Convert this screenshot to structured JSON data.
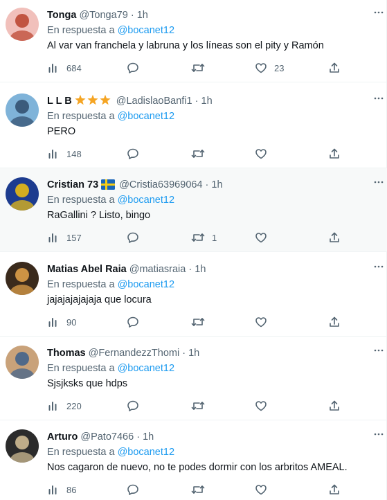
{
  "tweets": [
    {
      "name": "Tonga",
      "handle": "@Tonga79",
      "dot": "·",
      "time": "1h",
      "reply_prefix": "En respuesta a",
      "reply_to": "@bocanet12",
      "text": "Al var van franchela y labruna y los líneas son el pity y Ramón",
      "views": "684",
      "replies": "",
      "retweets": "",
      "likes": "23",
      "badge": "",
      "highlight": false,
      "avatar_colors": [
        "#f1c0bb",
        "#b9412b"
      ]
    },
    {
      "name": "L L B",
      "handle": "@LadislaoBanfi1",
      "dot": "·",
      "time": "1h",
      "reply_prefix": "En respuesta a",
      "reply_to": "@bocanet12",
      "text": "PERO",
      "views": "148",
      "replies": "",
      "retweets": "",
      "likes": "",
      "badge": "stars",
      "highlight": false,
      "avatar_colors": [
        "#7fb3d9",
        "#2f4b6b"
      ]
    },
    {
      "name": "Cristian 73",
      "handle": "@Cristia63969064",
      "dot": "·",
      "time": "1h",
      "reply_prefix": "En respuesta a",
      "reply_to": "@bocanet12",
      "text": "RaGallini ? Listo, bingo",
      "views": "157",
      "replies": "",
      "retweets": "1",
      "likes": "",
      "badge": "flag",
      "highlight": true,
      "avatar_colors": [
        "#1d3c8f",
        "#f4c20d"
      ]
    },
    {
      "name": "Matias Abel Raia",
      "handle": "@matiasraia",
      "dot": "·",
      "time": "1h",
      "reply_prefix": "En respuesta a",
      "reply_to": "@bocanet12",
      "text": "jajajajajajaja que locura",
      "views": "90",
      "replies": "",
      "retweets": "",
      "likes": "",
      "badge": "",
      "highlight": false,
      "avatar_colors": [
        "#3a2a1c",
        "#e8a64b"
      ]
    },
    {
      "name": "Thomas",
      "handle": "@FernandezzThomi",
      "dot": "·",
      "time": "1h",
      "reply_prefix": "En respuesta a",
      "reply_to": "@bocanet12",
      "text": "Sjsjksks que hdps",
      "views": "220",
      "replies": "",
      "retweets": "",
      "likes": "",
      "badge": "",
      "highlight": false,
      "avatar_colors": [
        "#c9a27a",
        "#3b5f8c"
      ]
    },
    {
      "name": "Arturo",
      "handle": "@Pato7466",
      "dot": "·",
      "time": "1h",
      "reply_prefix": "En respuesta a",
      "reply_to": "@bocanet12",
      "text": "Nos cagaron de nuevo, no te podes dormir con los arbritos AMEAL.",
      "views": "86",
      "replies": "",
      "retweets": "",
      "likes": "",
      "badge": "",
      "highlight": false,
      "avatar_colors": [
        "#2b2b2b",
        "#d9c49a"
      ]
    }
  ],
  "colors": {
    "text": "#0f1419",
    "muted": "#536471",
    "link": "#1d9bf0",
    "border": "#eff3f4",
    "hover": "#f7f9f9",
    "star": "#f5a524"
  }
}
